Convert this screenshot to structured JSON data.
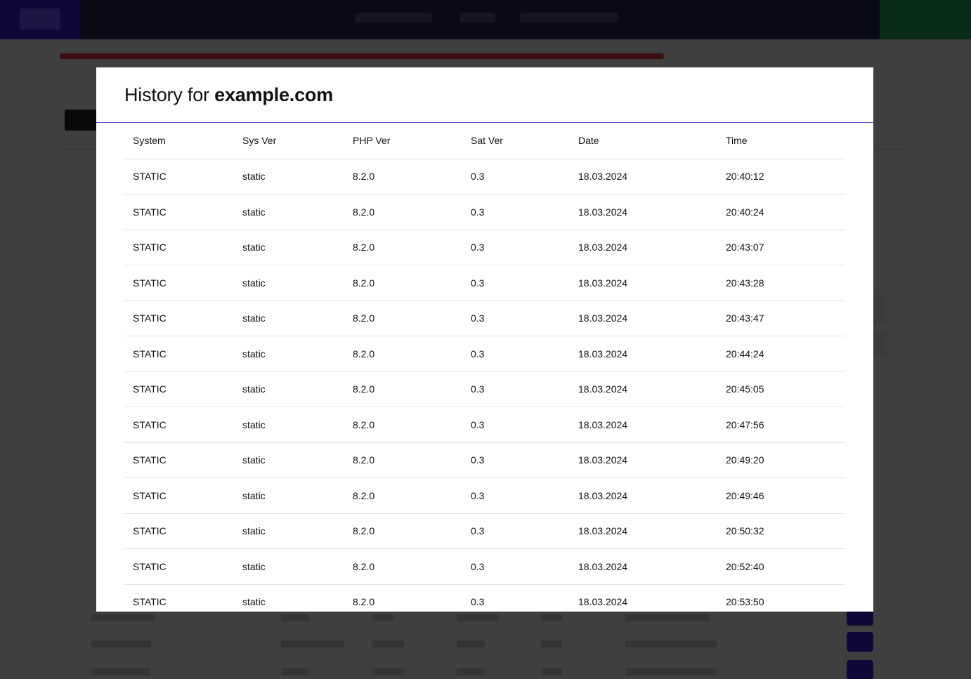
{
  "modal": {
    "title_prefix": "History for",
    "title_domain": "example.com"
  },
  "table": {
    "headers": [
      "System",
      "Sys Ver",
      "PHP Ver",
      "Sat Ver",
      "Date",
      "Time"
    ],
    "rows": [
      [
        "STATIC",
        "static",
        "8.2.0",
        "0.3",
        "18.03.2024",
        "20:40:12"
      ],
      [
        "STATIC",
        "static",
        "8.2.0",
        "0.3",
        "18.03.2024",
        "20:40:24"
      ],
      [
        "STATIC",
        "static",
        "8.2.0",
        "0.3",
        "18.03.2024",
        "20:43:07"
      ],
      [
        "STATIC",
        "static",
        "8.2.0",
        "0.3",
        "18.03.2024",
        "20:43:28"
      ],
      [
        "STATIC",
        "static",
        "8.2.0",
        "0.3",
        "18.03.2024",
        "20:43:47"
      ],
      [
        "STATIC",
        "static",
        "8.2.0",
        "0.3",
        "18.03.2024",
        "20:44:24"
      ],
      [
        "STATIC",
        "static",
        "8.2.0",
        "0.3",
        "18.03.2024",
        "20:45:05"
      ],
      [
        "STATIC",
        "static",
        "8.2.0",
        "0.3",
        "18.03.2024",
        "20:47:56"
      ],
      [
        "STATIC",
        "static",
        "8.2.0",
        "0.3",
        "18.03.2024",
        "20:49:20"
      ],
      [
        "STATIC",
        "static",
        "8.2.0",
        "0.3",
        "18.03.2024",
        "20:49:46"
      ],
      [
        "STATIC",
        "static",
        "8.2.0",
        "0.3",
        "18.03.2024",
        "20:50:32"
      ],
      [
        "STATIC",
        "static",
        "8.2.0",
        "0.3",
        "18.03.2024",
        "20:52:40"
      ],
      [
        "STATIC",
        "static",
        "8.2.0",
        "0.3",
        "18.03.2024",
        "20:53:50"
      ]
    ]
  },
  "colors": {
    "header_divider": "#5a52e0",
    "row_divider": "#e3e3e3",
    "overlay": "rgba(0,0,0,0.74)",
    "brand": "#3b1fd6"
  }
}
